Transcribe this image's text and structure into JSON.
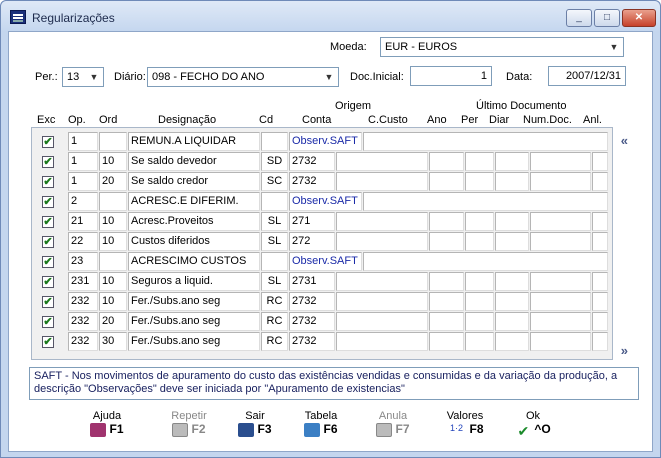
{
  "window": {
    "title": "Regularizações"
  },
  "form": {
    "moeda_label": "Moeda:",
    "moeda_value": "EUR - EUROS",
    "per_label": "Per.:",
    "per_value": "13",
    "diario_label": "Diário:",
    "diario_value": "098 - FECHO DO ANO",
    "doc_inicial_label": "Doc.Inicial:",
    "doc_inicial_value": "1",
    "data_label": "Data:",
    "data_value": "2007/12/31"
  },
  "headers": {
    "exc": "Exc",
    "op": "Op.",
    "ord": "Ord",
    "designacao": "Designação",
    "cd": "Cd",
    "origem": "Origem",
    "conta": "Conta",
    "ccusto": "C.Custo",
    "ultimo": "Último Documento",
    "ano": "Ano",
    "per": "Per",
    "diar": "Diar",
    "numdoc": "Num.Doc.",
    "anl": "Anl."
  },
  "rows": [
    {
      "op": "1",
      "ord": "",
      "des": "REMUN.A LIQUIDAR",
      "cd": "",
      "conta": "Observ.SAFT",
      "obs": true,
      "checked": true
    },
    {
      "op": "1",
      "ord": "10",
      "des": "Se saldo devedor",
      "cd": "SD",
      "conta": "2732",
      "obs": false,
      "checked": true
    },
    {
      "op": "1",
      "ord": "20",
      "des": "Se saldo credor",
      "cd": "SC",
      "conta": "2732",
      "obs": false,
      "checked": true
    },
    {
      "op": "2",
      "ord": "",
      "des": "ACRESC.E DIFERIM.",
      "cd": "",
      "conta": "Observ.SAFT",
      "obs": true,
      "checked": true
    },
    {
      "op": "21",
      "ord": "10",
      "des": "Acresc.Proveitos",
      "cd": "SL",
      "conta": "271",
      "obs": false,
      "checked": true
    },
    {
      "op": "22",
      "ord": "10",
      "des": "Custos diferidos",
      "cd": "SL",
      "conta": "272",
      "obs": false,
      "checked": true
    },
    {
      "op": "23",
      "ord": "",
      "des": "ACRESCIMO CUSTOS",
      "cd": "",
      "conta": "Observ.SAFT",
      "obs": true,
      "checked": true
    },
    {
      "op": "231",
      "ord": "10",
      "des": "Seguros a liquid.",
      "cd": "SL",
      "conta": "2731",
      "obs": false,
      "checked": true
    },
    {
      "op": "232",
      "ord": "10",
      "des": "Fer./Subs.ano seg",
      "cd": "RC",
      "conta": "2732",
      "obs": false,
      "checked": true
    },
    {
      "op": "232",
      "ord": "20",
      "des": "Fer./Subs.ano seg",
      "cd": "RC",
      "conta": "2732",
      "obs": false,
      "checked": true
    },
    {
      "op": "232",
      "ord": "30",
      "des": "Fer./Subs.ano seg",
      "cd": "RC",
      "conta": "2732",
      "obs": false,
      "checked": true
    }
  ],
  "info_text": "SAFT - Nos movimentos de apuramento do custo das existências vendidas e consumidas e da variação da produção, a descrição \"Observações\" deve ser iniciada por \"Apuramento de existencias\"",
  "buttons": [
    {
      "label": "Ajuda",
      "key": "F1",
      "icon": "book-icon",
      "disabled": false
    },
    {
      "label": "Repetir",
      "key": "F2",
      "icon": "repeat-icon",
      "disabled": true
    },
    {
      "label": "Sair",
      "key": "F3",
      "icon": "exit-icon",
      "disabled": false
    },
    {
      "label": "Tabela",
      "key": "F6",
      "icon": "table-icon",
      "disabled": false
    },
    {
      "label": "Anula",
      "key": "F7",
      "icon": "cancel-icon",
      "disabled": true
    },
    {
      "label": "Valores",
      "key": "F8",
      "icon": "values-icon",
      "disabled": false
    },
    {
      "label": "Ok",
      "key": "^O",
      "icon": "check-icon",
      "disabled": false
    }
  ],
  "nav": {
    "prev": "«",
    "next": "»"
  }
}
